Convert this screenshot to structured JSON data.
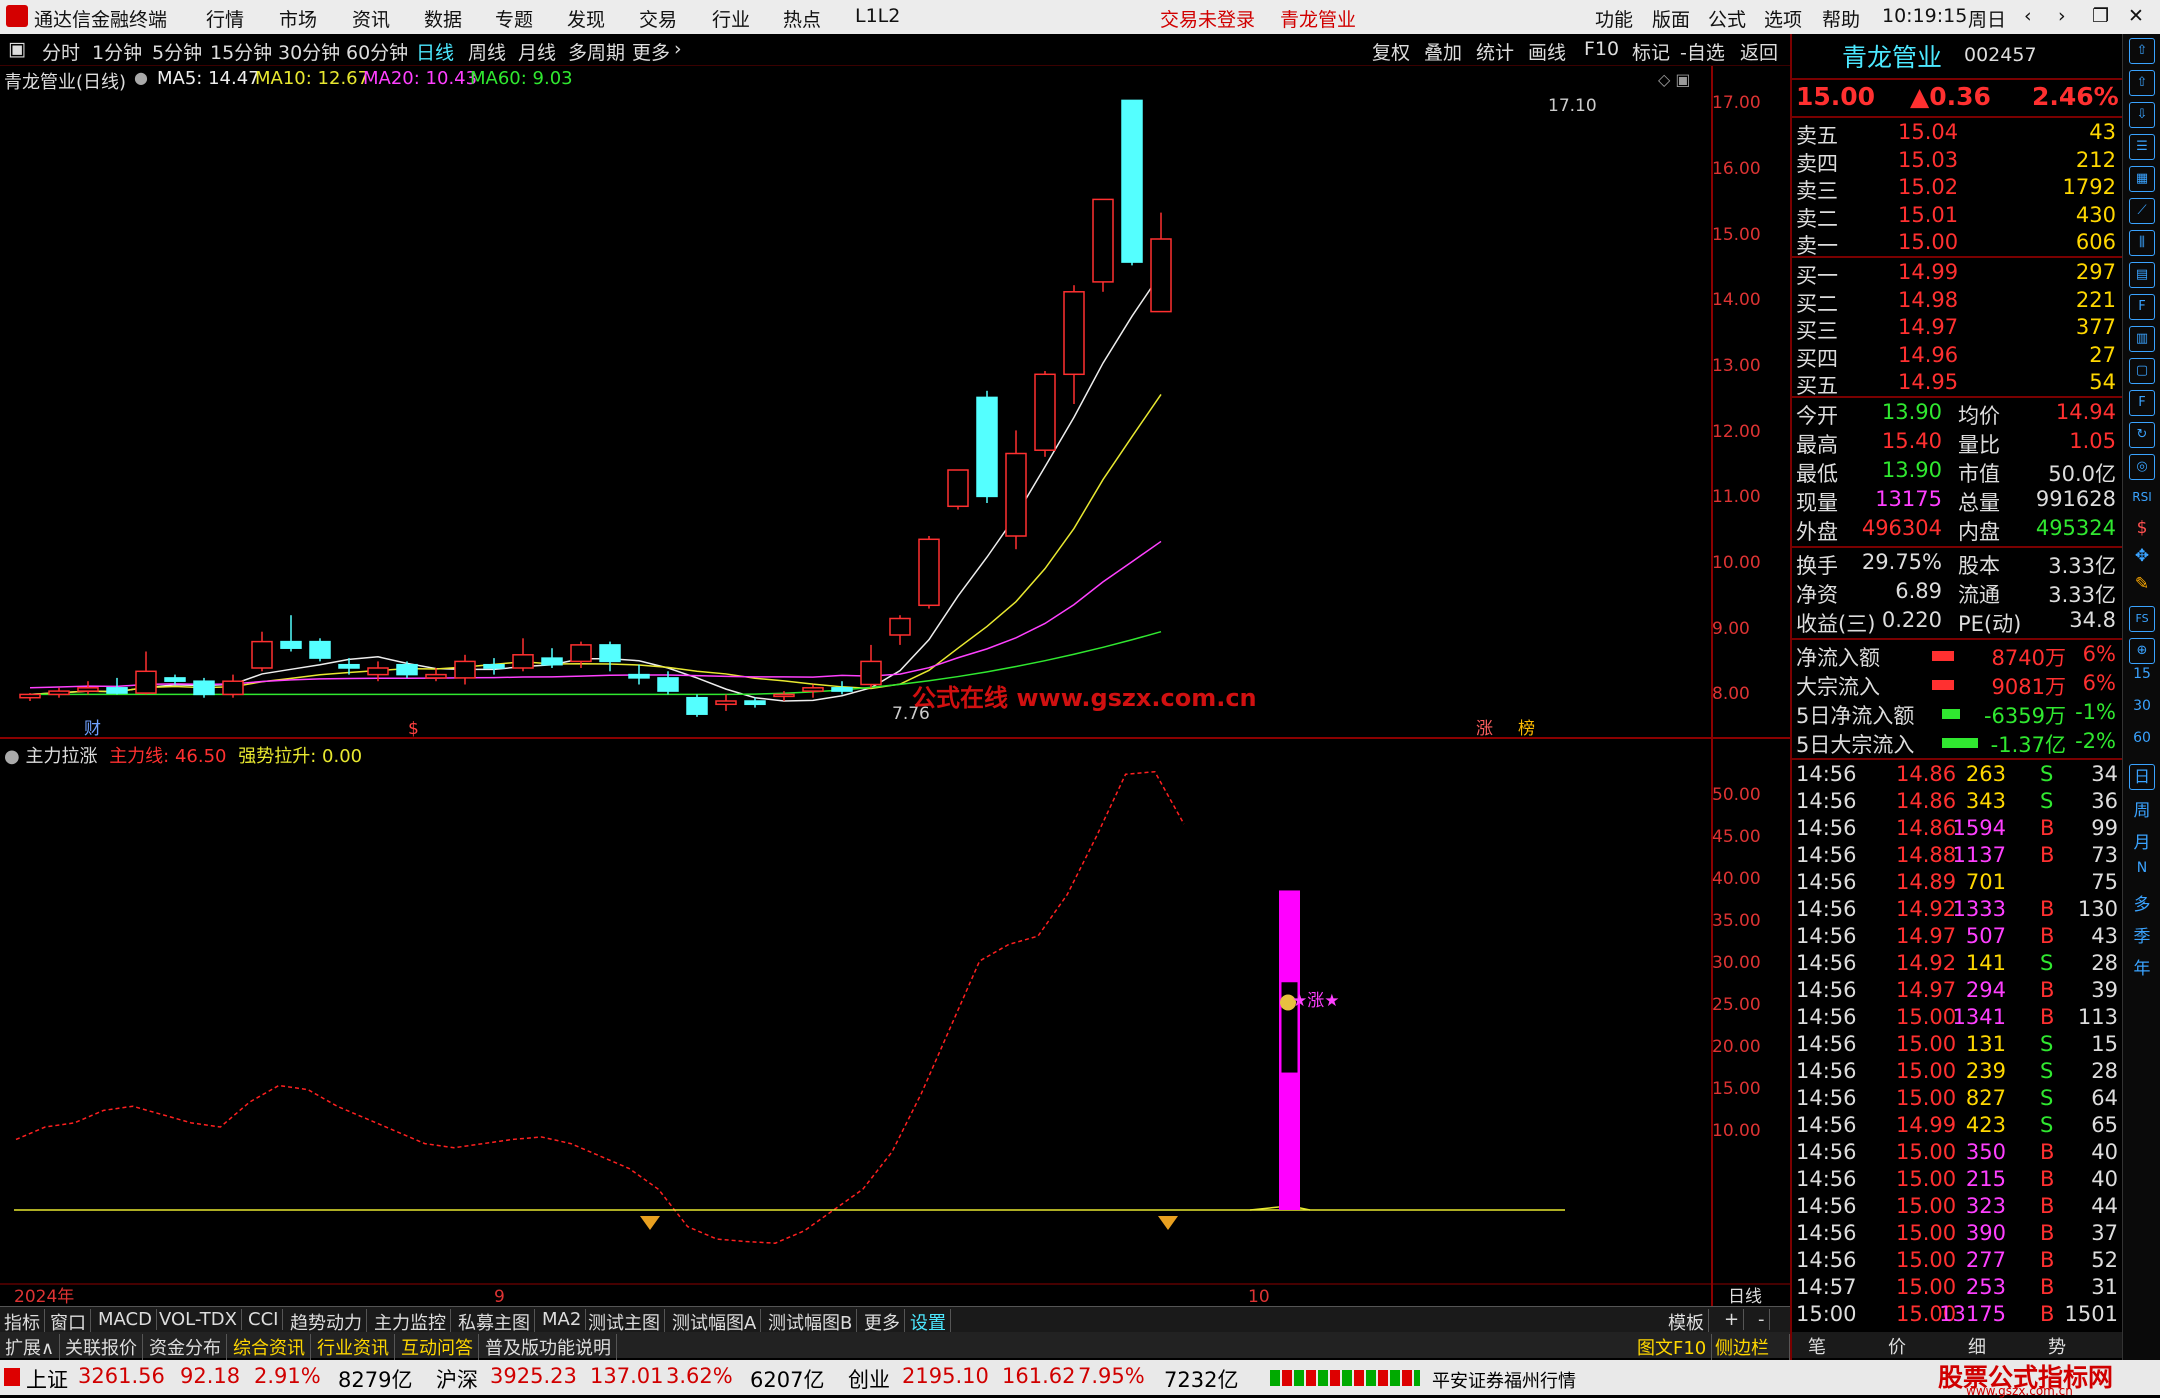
{
  "app_title": "通达信金融终端",
  "menu": [
    "行情",
    "市场",
    "资讯",
    "数据",
    "专题",
    "发现",
    "交易",
    "行业",
    "热点",
    "L1L2"
  ],
  "trade_status": "交易未登录",
  "menu_stock": "青龙管业",
  "menu_right": [
    "功能",
    "版面",
    "公式",
    "选项",
    "帮助"
  ],
  "clock": "10:19:15",
  "weekday": "周日",
  "periods": [
    "分时",
    "1分钟",
    "5分钟",
    "15分钟",
    "30分钟",
    "60分钟",
    "日线",
    "周线",
    "月线",
    "多周期",
    "更多"
  ],
  "toolbar_right": [
    "复权",
    "叠加",
    "统计",
    "画线",
    "F10",
    "标记",
    "-自选",
    "返回"
  ],
  "chart": {
    "title": "青龙管业(日线)",
    "ma5": "MA5: 14.47",
    "ma10": "MA10: 12.67",
    "ma20": "MA20: 10.43",
    "ma60": "MA60: 9.03",
    "high_label": "17.10",
    "low_label": "7.76",
    "y_ticks": [
      "17.00",
      "16.00",
      "15.00",
      "14.00",
      "13.00",
      "12.00",
      "11.00",
      "10.00",
      "9.00",
      "8.00"
    ],
    "watermark": "公式在线 www.gszx.com.cn",
    "markers": [
      "财",
      "$",
      "涨",
      "榜"
    ]
  },
  "indicator": {
    "name": "主力拉涨",
    "line1": "主力线: 46.50",
    "line2": "强势拉升: 0.00",
    "y_ticks": [
      "50.00",
      "45.00",
      "40.00",
      "35.00",
      "30.00",
      "25.00",
      "20.00",
      "15.00",
      "10.00"
    ],
    "signal": "★涨★"
  },
  "x_axis": [
    "2024年",
    "9",
    "10"
  ],
  "x_axis_right": "日线",
  "chart_data": {
    "type": "candlestick",
    "y_range": [
      7.5,
      17.3
    ],
    "candles": [
      {
        "o": 8.05,
        "h": 8.12,
        "l": 8.0,
        "c": 8.1
      },
      {
        "o": 8.1,
        "h": 8.2,
        "l": 8.05,
        "c": 8.15
      },
      {
        "o": 8.15,
        "h": 8.3,
        "l": 8.1,
        "c": 8.2
      },
      {
        "o": 8.2,
        "h": 8.35,
        "l": 8.1,
        "c": 8.12
      },
      {
        "o": 8.12,
        "h": 8.75,
        "l": 8.1,
        "c": 8.45
      },
      {
        "o": 8.35,
        "h": 8.4,
        "l": 8.25,
        "c": 8.3
      },
      {
        "o": 8.3,
        "h": 8.35,
        "l": 8.05,
        "c": 8.1
      },
      {
        "o": 8.1,
        "h": 8.4,
        "l": 8.05,
        "c": 8.3
      },
      {
        "o": 8.5,
        "h": 9.05,
        "l": 8.45,
        "c": 8.9
      },
      {
        "o": 8.9,
        "h": 9.3,
        "l": 8.75,
        "c": 8.8
      },
      {
        "o": 8.9,
        "h": 8.95,
        "l": 8.6,
        "c": 8.65
      },
      {
        "o": 8.55,
        "h": 8.65,
        "l": 8.4,
        "c": 8.5
      },
      {
        "o": 8.4,
        "h": 8.6,
        "l": 8.3,
        "c": 8.5
      },
      {
        "o": 8.55,
        "h": 8.6,
        "l": 8.35,
        "c": 8.4
      },
      {
        "o": 8.35,
        "h": 8.5,
        "l": 8.3,
        "c": 8.4
      },
      {
        "o": 8.35,
        "h": 8.7,
        "l": 8.25,
        "c": 8.6
      },
      {
        "o": 8.55,
        "h": 8.65,
        "l": 8.4,
        "c": 8.5
      },
      {
        "o": 8.5,
        "h": 8.95,
        "l": 8.45,
        "c": 8.7
      },
      {
        "o": 8.65,
        "h": 8.8,
        "l": 8.5,
        "c": 8.55
      },
      {
        "o": 8.6,
        "h": 8.9,
        "l": 8.5,
        "c": 8.85
      },
      {
        "o": 8.85,
        "h": 8.9,
        "l": 8.45,
        "c": 8.6
      },
      {
        "o": 8.4,
        "h": 8.55,
        "l": 8.25,
        "c": 8.35
      },
      {
        "o": 8.35,
        "h": 8.45,
        "l": 8.1,
        "c": 8.15
      },
      {
        "o": 8.05,
        "h": 8.1,
        "l": 7.76,
        "c": 7.8
      },
      {
        "o": 7.95,
        "h": 8.1,
        "l": 7.85,
        "c": 8.0
      },
      {
        "o": 8.0,
        "h": 8.05,
        "l": 7.9,
        "c": 7.95
      },
      {
        "o": 8.1,
        "h": 8.15,
        "l": 8.0,
        "c": 8.1
      },
      {
        "o": 8.15,
        "h": 8.25,
        "l": 8.05,
        "c": 8.2
      },
      {
        "o": 8.2,
        "h": 8.3,
        "l": 8.1,
        "c": 8.15
      },
      {
        "o": 8.25,
        "h": 8.85,
        "l": 8.2,
        "c": 8.6
      },
      {
        "o": 9.0,
        "h": 9.3,
        "l": 8.85,
        "c": 9.25
      },
      {
        "o": 9.45,
        "h": 10.5,
        "l": 9.4,
        "c": 10.45
      },
      {
        "o": 10.95,
        "h": 11.5,
        "l": 10.9,
        "c": 11.5
      },
      {
        "o": 12.6,
        "h": 12.7,
        "l": 11.0,
        "c": 11.1
      },
      {
        "o": 10.5,
        "h": 12.1,
        "l": 10.3,
        "c": 11.75
      },
      {
        "o": 11.8,
        "h": 13.0,
        "l": 11.7,
        "c": 12.95
      },
      {
        "o": 12.95,
        "h": 14.3,
        "l": 12.5,
        "c": 14.2
      },
      {
        "o": 14.35,
        "h": 15.6,
        "l": 14.2,
        "c": 15.6
      },
      {
        "o": 17.1,
        "h": 17.1,
        "l": 14.6,
        "c": 14.65
      },
      {
        "o": 13.9,
        "h": 15.4,
        "l": 13.9,
        "c": 15.0
      }
    ]
  },
  "quote": {
    "name": "青龙管业",
    "code": "002457",
    "price": "15.00",
    "change": "▲0.36",
    "pct": "2.46%",
    "asks": [
      [
        "卖五",
        "15.04",
        "43"
      ],
      [
        "卖四",
        "15.03",
        "212"
      ],
      [
        "卖三",
        "15.02",
        "1792"
      ],
      [
        "卖二",
        "15.01",
        "430"
      ],
      [
        "卖一",
        "15.00",
        "606"
      ]
    ],
    "bids": [
      [
        "买一",
        "14.99",
        "297"
      ],
      [
        "买二",
        "14.98",
        "221"
      ],
      [
        "买三",
        "14.97",
        "377"
      ],
      [
        "买四",
        "14.96",
        "27"
      ],
      [
        "买五",
        "14.95",
        "54"
      ]
    ],
    "stats": [
      [
        "今开",
        "13.90",
        "均价",
        "14.94"
      ],
      [
        "最高",
        "15.40",
        "量比",
        "1.05"
      ],
      [
        "最低",
        "13.90",
        "市值",
        "50.0亿"
      ],
      [
        "现量",
        "13175",
        "总量",
        "991628"
      ],
      [
        "外盘",
        "496304",
        "内盘",
        "495324"
      ]
    ],
    "stats2": [
      [
        "换手",
        "29.75%",
        "股本",
        "3.33亿"
      ],
      [
        "净资",
        "6.89",
        "流通",
        "3.33亿"
      ],
      [
        "收益(三)",
        "0.220",
        "PE(动)",
        "34.8"
      ]
    ],
    "flows": [
      [
        "净流入额",
        "8740万",
        "6%"
      ],
      [
        "大宗流入",
        "9081万",
        "6%"
      ],
      [
        "5日净流入额",
        "-6359万",
        "-1%"
      ],
      [
        "5日大宗流入",
        "-1.37亿",
        "-2%"
      ]
    ],
    "ticks": [
      [
        "14:56",
        "14.86",
        "263",
        "S",
        "34"
      ],
      [
        "14:56",
        "14.86",
        "343",
        "S",
        "36"
      ],
      [
        "14:56",
        "14.86",
        "1594",
        "B",
        "99"
      ],
      [
        "14:56",
        "14.88",
        "1137",
        "B",
        "73"
      ],
      [
        "14:56",
        "14.89",
        "701",
        "",
        "75"
      ],
      [
        "14:56",
        "14.92",
        "1333",
        "B",
        "130"
      ],
      [
        "14:56",
        "14.97",
        "507",
        "B",
        "43"
      ],
      [
        "14:56",
        "14.92",
        "141",
        "S",
        "28"
      ],
      [
        "14:56",
        "14.97",
        "294",
        "B",
        "39"
      ],
      [
        "14:56",
        "15.00",
        "1341",
        "B",
        "113"
      ],
      [
        "14:56",
        "15.00",
        "131",
        "S",
        "15"
      ],
      [
        "14:56",
        "15.00",
        "239",
        "S",
        "28"
      ],
      [
        "14:56",
        "15.00",
        "827",
        "S",
        "64"
      ],
      [
        "14:56",
        "14.99",
        "423",
        "S",
        "65"
      ],
      [
        "14:56",
        "15.00",
        "350",
        "B",
        "40"
      ],
      [
        "14:56",
        "15.00",
        "215",
        "B",
        "40"
      ],
      [
        "14:56",
        "15.00",
        "323",
        "B",
        "44"
      ],
      [
        "14:56",
        "15.00",
        "390",
        "B",
        "37"
      ],
      [
        "14:56",
        "15.00",
        "277",
        "B",
        "52"
      ],
      [
        "14:57",
        "15.00",
        "253",
        "B",
        "31"
      ],
      [
        "15:00",
        "15.00",
        "13175",
        "B",
        "1501"
      ]
    ]
  },
  "bottom_tabs": [
    "指标",
    "窗口",
    "MACD",
    "VOL-TDX",
    "CCI",
    "趋势动力",
    "主力监控",
    "私募主图",
    "MA2",
    "测试主图",
    "测试幅图A",
    "测试幅图B",
    "更多",
    "设置"
  ],
  "bottom_right": [
    "模板",
    "+",
    "-"
  ],
  "ext_tabs": [
    "扩展∧",
    "关联报价",
    "资金分布",
    "综合资讯",
    "行业资讯",
    "互动问答",
    "普及版功能说明"
  ],
  "ext_right": [
    "图文F10",
    "侧边栏《"
  ],
  "rp_tabs": [
    "笔",
    "价",
    "细",
    "势"
  ],
  "status": {
    "idx1": [
      "上证",
      "3261.56",
      "92.18",
      "2.91%",
      "8279亿"
    ],
    "idx2": [
      "沪深",
      "3925.23",
      "137.01",
      "3.62%",
      "6207亿"
    ],
    "idx3": [
      "创业",
      "2195.10",
      "161.62",
      "7.95%",
      "7232亿"
    ],
    "broker": "平安证券福州行情",
    "logo": "股票公式指标网",
    "logo_url": "www.gszx.com.cn"
  },
  "side_icons": [
    "15",
    "30",
    "60",
    "日",
    "周",
    "月",
    "N",
    "多",
    "季",
    "年"
  ]
}
